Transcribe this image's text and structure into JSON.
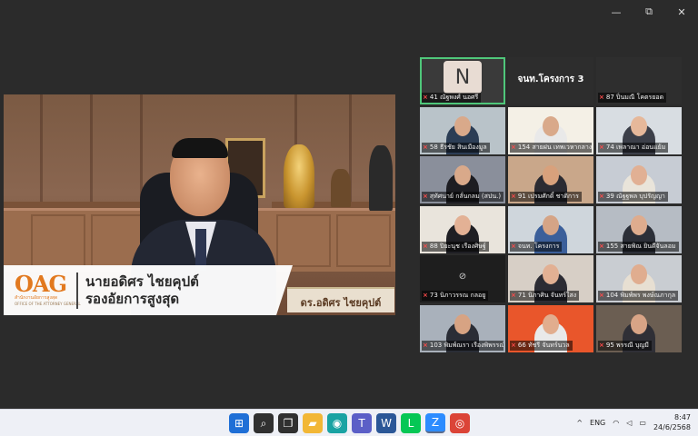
{
  "window": {
    "controls": {
      "minimize": "—",
      "restore": "⧉",
      "close": "✕"
    }
  },
  "speaker": {
    "logo": {
      "brand": "OAG",
      "thai": "สำนักงานอัยการสูงสุด",
      "english": "OFFICE OF THE ATTORNEY GENERAL"
    },
    "name": "นายอดิศร ไชยคุปต์",
    "position": "รองอัยการสูงสุด",
    "desk_plate": "ดร.อดิศร ไชยคุปต์"
  },
  "participants": [
    {
      "label": "41 ณัฐพงศ์ นอศรี",
      "avatar": "N",
      "muted": true,
      "active": true,
      "bg": "#3a3a3a",
      "skin": ""
    },
    {
      "label": "",
      "big_name": "จนท.โครงการ 3",
      "muted": false,
      "bg": "#2d2d2d",
      "skin": ""
    },
    {
      "label": "87 ปิ่นมณี โคตรยอด",
      "muted": true,
      "bg": "#2e2e2e",
      "skin": ""
    },
    {
      "label": "58 ธีรชัย สินเมืองมูล",
      "muted": true,
      "bg": "#b9c3c9",
      "skin": "#d9a98a",
      "shirt": "#2b3d55"
    },
    {
      "label": "154 สายฝน เทพเวหากลาง",
      "muted": true,
      "bg": "#f4f0e6",
      "skin": "#d9a98a",
      "shirt": "#e9e9e9"
    },
    {
      "label": "74 เพลาณา อ่อนแย้ม",
      "muted": true,
      "bg": "#d8dde2",
      "skin": "#e6b89a",
      "shirt": "#3c3f49"
    },
    {
      "label": "สุทัศนาย์ กลั่นกลม (สปน.)",
      "muted": true,
      "bg": "#8a8f9b",
      "skin": "#d9a98a",
      "shirt": "#1d1d22"
    },
    {
      "label": "91 เปรมศักดิ์ ชาติการ",
      "muted": true,
      "bg": "#c9a78a",
      "skin": "#d8a17c",
      "shirt": "#2b2b32"
    },
    {
      "label": "39 ณัฐฐพล บุปรัญญา",
      "muted": true,
      "bg": "#c7ccd4",
      "skin": "#e1b094",
      "shirt": "#e9e4da"
    },
    {
      "label": "88 ปิยะนุช เรืองศิษฐ์",
      "muted": true,
      "bg": "#e9e4dc",
      "skin": "#e3b195",
      "shirt": "#1f1f24"
    },
    {
      "label": "จนท. โครงการ",
      "muted": true,
      "bg": "#cfd6dc",
      "skin": "#d5a486",
      "shirt": "#3b5f9a"
    },
    {
      "label": "155 สายพิณ ยินดีจันลอม",
      "muted": true,
      "bg": "#b6bcc4",
      "skin": "#deac8e",
      "shirt": "#2c2f38"
    },
    {
      "label": "73 นิภาวรรณ กลอยู",
      "muted": true,
      "bg": "#1e1e1e",
      "cam_off": true,
      "skin": ""
    },
    {
      "label": "71 นิภาศิน จันทร์ใสง",
      "muted": true,
      "bg": "#d7cfc6",
      "skin": "#e2b093",
      "shirt": "#2c2c34"
    },
    {
      "label": "104 พิมพ์พร พงษ์ณภากุล",
      "muted": true,
      "bg": "#c9cdd2",
      "skin": "#e0ad8f",
      "shirt": "#e7dfd2"
    },
    {
      "label": "103 พิมพ์ณรา เรืองพิพรรณ์",
      "muted": true,
      "bg": "#a9b1bb",
      "skin": "#d7a383",
      "shirt": "#2a2d36"
    },
    {
      "label": "66 ทัชรี จันทร์นวล",
      "muted": true,
      "bg": "#e9562b",
      "skin": "#e1ad8e",
      "shirt": "#e9e9e9"
    },
    {
      "label": "95 พรรณี บุญมี",
      "muted": true,
      "bg": "#6b5e52",
      "skin": "#d8a486",
      "shirt": "#2f2f36"
    }
  ],
  "taskbar": {
    "icons": [
      {
        "name": "windows-start-icon",
        "glyph": "⊞",
        "color": "#1f6fd6",
        "running": false
      },
      {
        "name": "search-icon",
        "glyph": "⌕",
        "color": "#303030",
        "running": false
      },
      {
        "name": "task-view-icon",
        "glyph": "❐",
        "color": "#303030",
        "running": false
      },
      {
        "name": "file-explorer-icon",
        "glyph": "▰",
        "color": "#f2b736",
        "running": false
      },
      {
        "name": "edge-icon",
        "glyph": "◉",
        "color": "#1aa3a3",
        "running": false
      },
      {
        "name": "teams-icon",
        "glyph": "T",
        "color": "#5b5fc7",
        "running": false
      },
      {
        "name": "word-icon",
        "glyph": "W",
        "color": "#2b5797",
        "running": false
      },
      {
        "name": "line-icon",
        "glyph": "L",
        "color": "#06c755",
        "running": false
      },
      {
        "name": "zoom-icon",
        "glyph": "Z",
        "color": "#2d8cff",
        "running": true
      },
      {
        "name": "chrome-icon",
        "glyph": "◎",
        "color": "#db4437",
        "running": false
      }
    ],
    "tray": {
      "chevron": "^",
      "lang": "ENG",
      "wifi": "◠",
      "volume": "◁",
      "battery": "▭"
    },
    "time": "8:47",
    "date": "24/6/2568"
  }
}
